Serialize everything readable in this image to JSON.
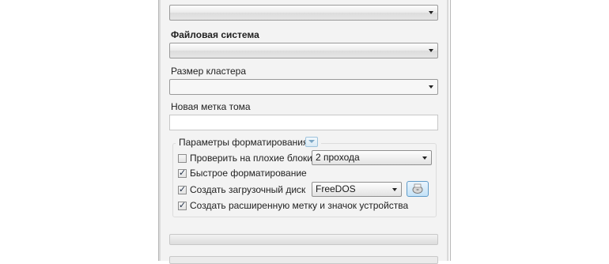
{
  "form": {
    "filesystem_label": "Файловая система",
    "cluster_label": "Размер кластера",
    "volume_label": "Новая метка тома",
    "volume_value": ""
  },
  "format_options": {
    "title": "Параметры форматирования",
    "bad_blocks": {
      "label": "Проверить на плохие блоки",
      "checked": false,
      "passes": "2 прохода"
    },
    "quick_format": {
      "label": "Быстрое форматирование",
      "checked": true
    },
    "bootable": {
      "label": "Создать загрузочный диск",
      "checked": true,
      "type": "FreeDOS"
    },
    "extended_label": {
      "label": "Создать расширенную метку и значок устройства",
      "checked": true
    }
  },
  "icons": {
    "toggle": "chevron-down-icon",
    "boot_image": "disk-image-icon"
  },
  "colors": {
    "window_bg": "#f3f3f3",
    "accent_border": "#5f9bc9"
  }
}
